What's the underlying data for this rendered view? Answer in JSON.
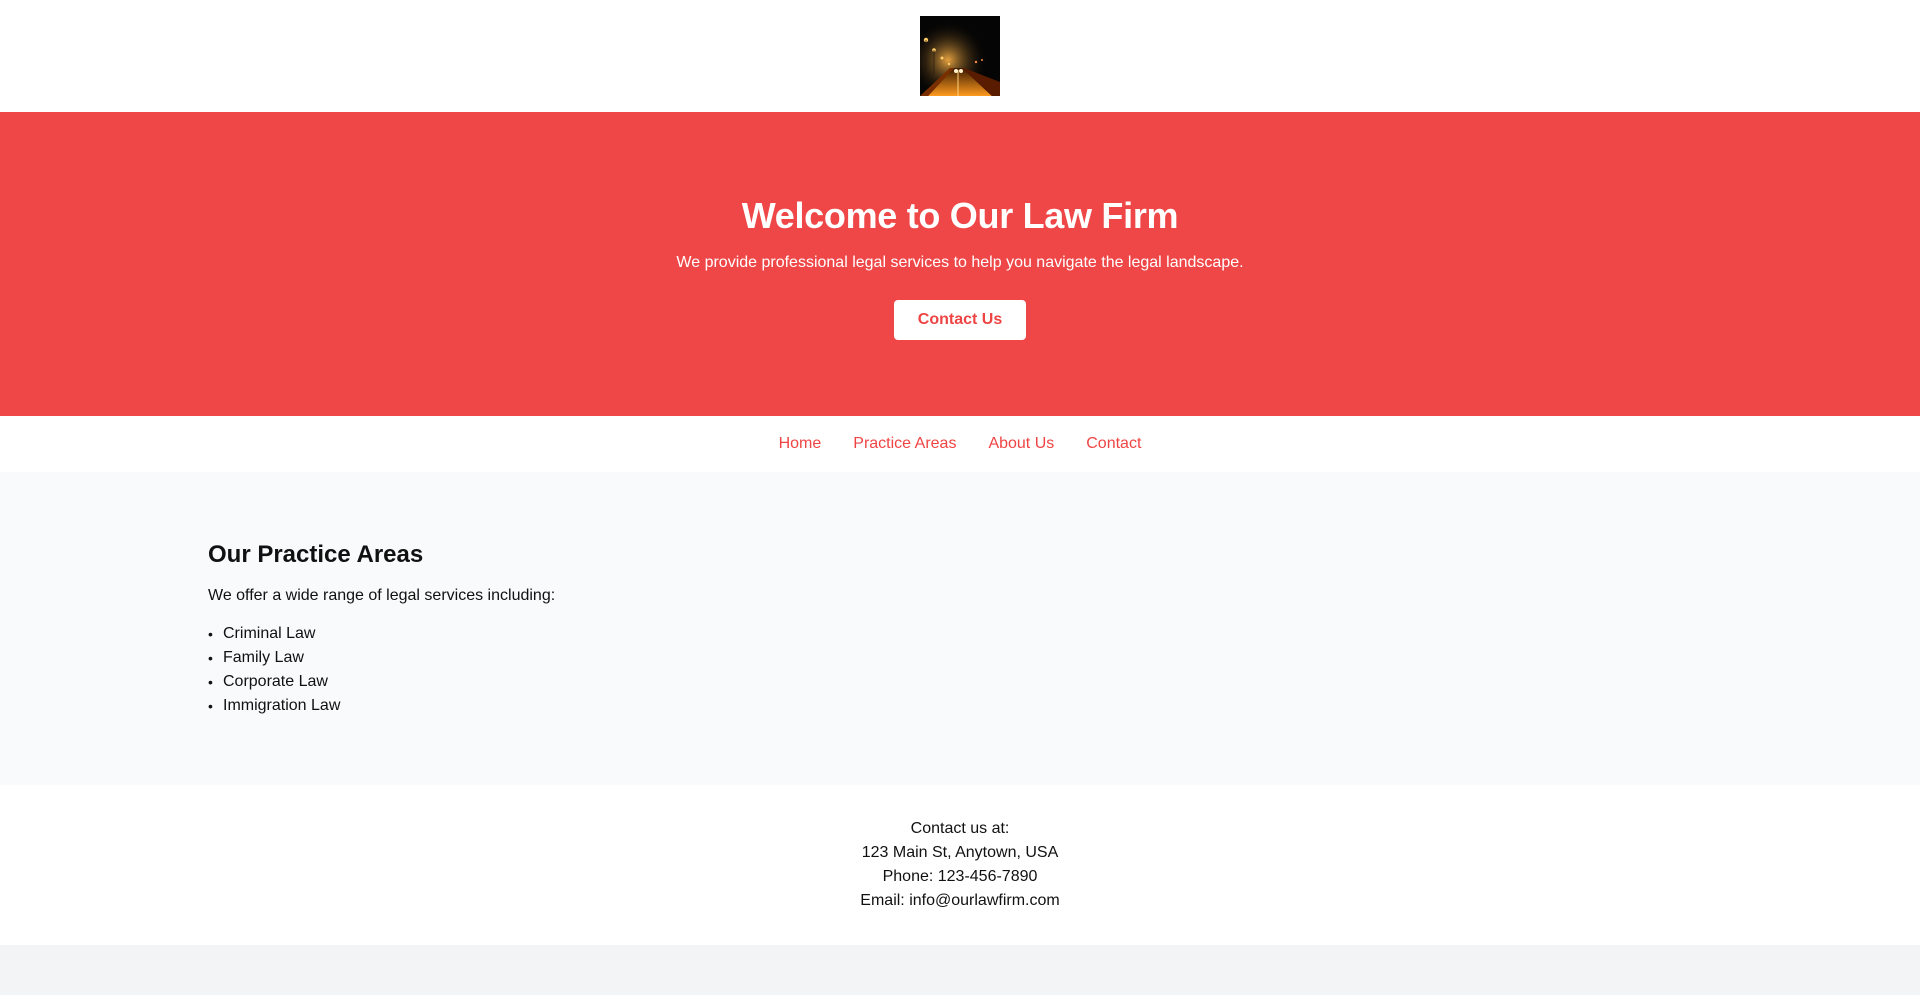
{
  "header": {
    "logo_icon": "night-road-icon"
  },
  "hero": {
    "title": "Welcome to Our Law Firm",
    "subtitle": "We provide professional legal services to help you navigate the legal landscape.",
    "button_label": "Contact Us",
    "background_color": "#ef4647",
    "button_text_color": "#ef4444"
  },
  "nav": {
    "items": [
      {
        "label": "Home"
      },
      {
        "label": "Practice Areas"
      },
      {
        "label": "About Us"
      },
      {
        "label": "Contact"
      }
    ],
    "link_color": "#ef4444"
  },
  "practice": {
    "title": "Our Practice Areas",
    "intro": "We offer a wide range of legal services including:",
    "items": [
      "Criminal Law",
      "Family Law",
      "Corporate Law",
      "Immigration Law"
    ]
  },
  "footer": {
    "lines": [
      "Contact us at:",
      "123 Main St, Anytown, USA",
      "Phone: 123-456-7890",
      "Email: info@ourlawfirm.com"
    ]
  }
}
